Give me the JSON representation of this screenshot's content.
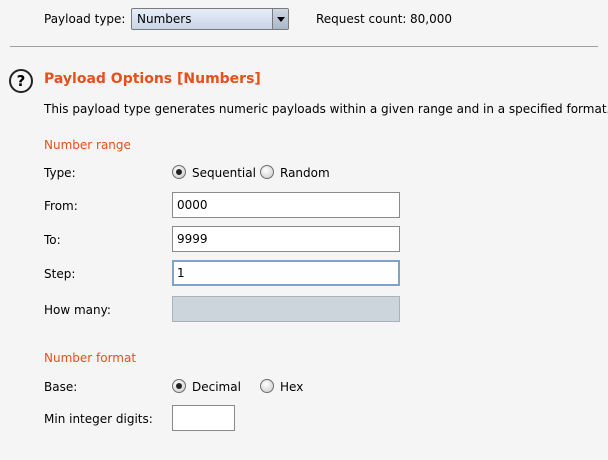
{
  "header": {
    "payload_type_label": "Payload type:",
    "payload_type_value": "Numbers",
    "request_count_label": "Request count:",
    "request_count_value": "80,000"
  },
  "options": {
    "title": "Payload Options [Numbers]",
    "description": "This payload type generates numeric payloads within a given range and in a specified format.",
    "help_icon_glyph": "?"
  },
  "number_range": {
    "heading": "Number range",
    "type_label": "Type:",
    "type_options": [
      "Sequential",
      "Random"
    ],
    "type_selected": "Sequential",
    "from_label": "From:",
    "from_value": "0000",
    "to_label": "To:",
    "to_value": "9999",
    "step_label": "Step:",
    "step_value": "1",
    "how_many_label": "How many:",
    "how_many_value": ""
  },
  "number_format": {
    "heading": "Number format",
    "base_label": "Base:",
    "base_options": [
      "Decimal",
      "Hex"
    ],
    "base_selected": "Decimal",
    "min_int_digits_label": "Min integer digits:",
    "min_int_digits_value": ""
  },
  "colors": {
    "accent": "#e8501a",
    "background": "#f5f5f5"
  }
}
